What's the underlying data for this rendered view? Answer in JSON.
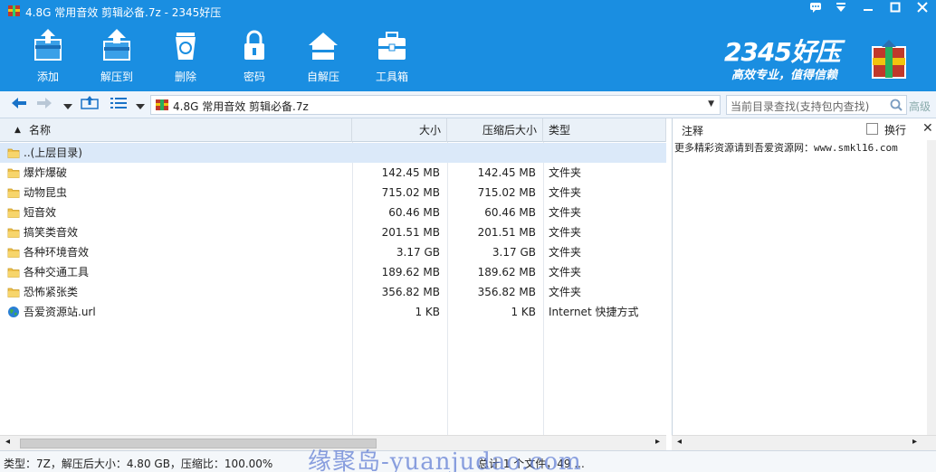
{
  "window": {
    "title": "4.8G 常用音效 剪辑必备.7z - 2345好压"
  },
  "toolbar": {
    "items": [
      {
        "label": "添加",
        "icon": "add-archive-icon"
      },
      {
        "label": "解压到",
        "icon": "extract-icon"
      },
      {
        "label": "删除",
        "icon": "delete-icon"
      },
      {
        "label": "密码",
        "icon": "lock-icon"
      },
      {
        "label": "自解压",
        "icon": "self-extract-icon"
      },
      {
        "label": "工具箱",
        "icon": "toolbox-icon"
      }
    ]
  },
  "brand": {
    "name": "2345好压",
    "slogan": "高效专业，值得信赖"
  },
  "address": {
    "path": "4.8G 常用音效 剪辑必备.7z",
    "search_placeholder": "当前目录查找(支持包内查找)",
    "advanced": "高级"
  },
  "list": {
    "columns": {
      "name": "名称",
      "size": "大小",
      "packed": "压缩后大小",
      "type": "类型"
    },
    "rows": [
      {
        "name": "..(上层目录)",
        "size": "",
        "packed": "",
        "type": "",
        "icon": "folder-icon"
      },
      {
        "name": "爆炸爆破",
        "size": "142.45 MB",
        "packed": "142.45 MB",
        "type": "文件夹",
        "icon": "folder-icon"
      },
      {
        "name": "动物昆虫",
        "size": "715.02 MB",
        "packed": "715.02 MB",
        "type": "文件夹",
        "icon": "folder-icon"
      },
      {
        "name": "短音效",
        "size": "60.46 MB",
        "packed": "60.46 MB",
        "type": "文件夹",
        "icon": "folder-icon"
      },
      {
        "name": "搞笑类音效",
        "size": "201.51 MB",
        "packed": "201.51 MB",
        "type": "文件夹",
        "icon": "folder-icon"
      },
      {
        "name": "各种环境音效",
        "size": "3.17 GB",
        "packed": "3.17 GB",
        "type": "文件夹",
        "icon": "folder-icon"
      },
      {
        "name": "各种交通工具",
        "size": "189.62 MB",
        "packed": "189.62 MB",
        "type": "文件夹",
        "icon": "folder-icon"
      },
      {
        "name": "恐怖紧张类",
        "size": "356.82 MB",
        "packed": "356.82 MB",
        "type": "文件夹",
        "icon": "folder-icon"
      },
      {
        "name": "吾爱资源站.url",
        "size": "1 KB",
        "packed": "1 KB",
        "type": "Internet 快捷方式",
        "icon": "globe-icon"
      }
    ]
  },
  "comment": {
    "title": "注释",
    "wrap_label": "换行",
    "text": "更多精彩资源请到吾爱资源网：www.smkl16.com"
  },
  "status": {
    "left": "类型：7Z，解压后大小：4.80 GB，压缩比：100.00%",
    "middle": "总计 1 个文件，49 ..."
  },
  "watermark": "缘聚岛-yuanjudao.com",
  "colors": {
    "toolbar_bg": "#1a8ee1",
    "selected_row": "#dbe9f9"
  }
}
